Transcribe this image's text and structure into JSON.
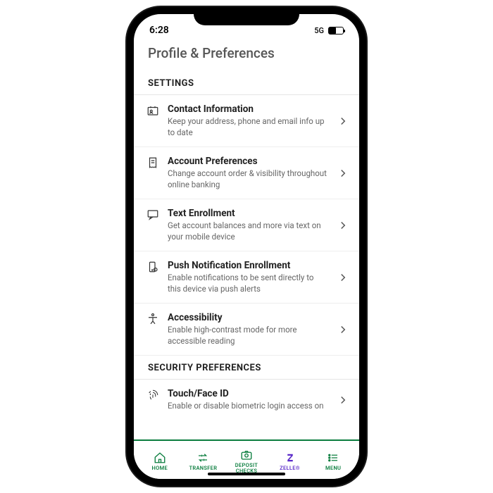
{
  "status": {
    "time": "6:28",
    "network": "5G"
  },
  "header": {
    "title": "Profile & Preferences"
  },
  "sections": {
    "settings": {
      "title": "SETTINGS",
      "items": [
        {
          "title": "Contact Information",
          "desc": "Keep your address, phone and email info up to date"
        },
        {
          "title": "Account Preferences",
          "desc": "Change account order & visibility throughout online banking"
        },
        {
          "title": "Text Enrollment",
          "desc": "Get account balances and more via text on your mobile device"
        },
        {
          "title": "Push Notification Enrollment",
          "desc": "Enable notifications to be sent directly to this device via push alerts"
        },
        {
          "title": "Accessibility",
          "desc": "Enable high-contrast mode for more accessible reading"
        }
      ]
    },
    "security": {
      "title": "SECURITY PREFERENCES",
      "items": [
        {
          "title": "Touch/Face ID",
          "desc": "Enable or disable biometric login access on"
        }
      ]
    }
  },
  "tabs": [
    {
      "label": "HOME"
    },
    {
      "label": "TRANSFER"
    },
    {
      "label": "DEPOSIT CHECKS"
    },
    {
      "label": "ZELLE®"
    },
    {
      "label": "MENU"
    }
  ]
}
